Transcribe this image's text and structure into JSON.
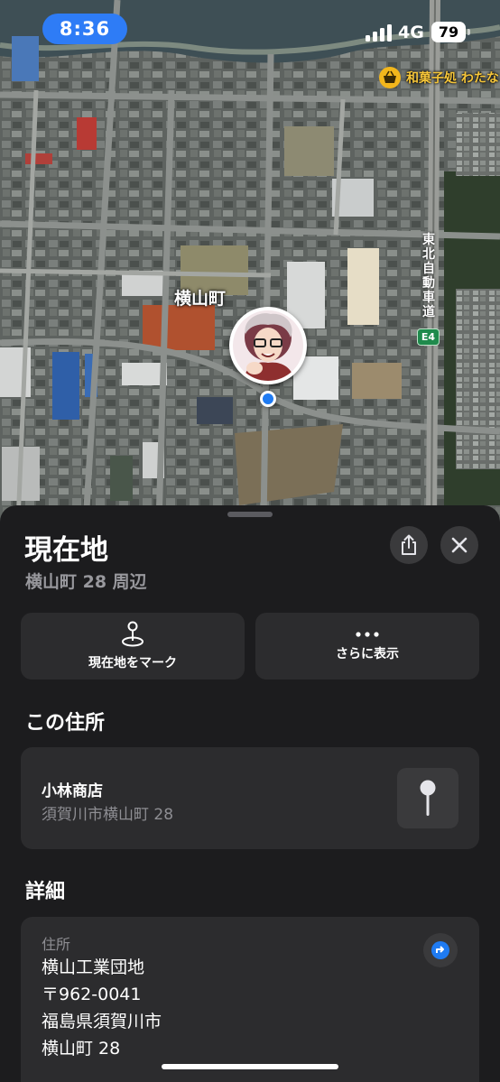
{
  "status_bar": {
    "time": "8:36",
    "network": "4G",
    "battery": "79"
  },
  "map": {
    "poi_label": "和菓子処 わたな",
    "town_label": "横山町",
    "highway_label": "東北自動車道",
    "highway_route": "E4"
  },
  "sheet": {
    "title": "現在地",
    "subtitle": "横山町 28 周辺",
    "actions": [
      {
        "label": "現在地をマーク",
        "icon": "location-pin-icon"
      },
      {
        "label": "さらに表示",
        "icon": "ellipsis-icon"
      }
    ],
    "address_section": {
      "heading": "この住所",
      "place_name": "小林商店",
      "place_address": "須賀川市横山町 28"
    },
    "details_section": {
      "heading": "詳細",
      "label": "住所",
      "lines": [
        "横山工業団地",
        "〒962-0041",
        "福島県須賀川市",
        "横山町 28"
      ]
    }
  },
  "colors": {
    "accent": "#1f7bf2",
    "time_pill": "#2e7cf6",
    "poi": "#f2b61c",
    "background": "#1c1c1e"
  }
}
